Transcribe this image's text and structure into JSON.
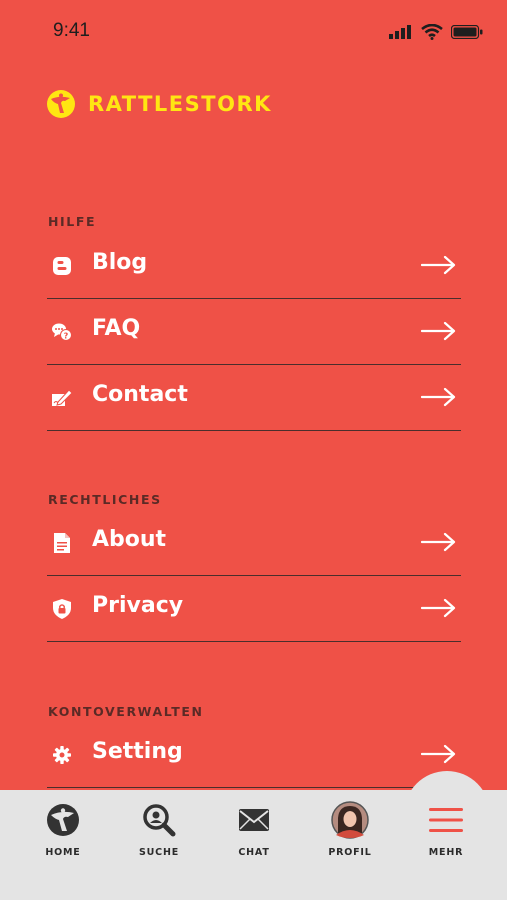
{
  "status": {
    "time": "9:41"
  },
  "brand": {
    "name": "RATTLESTORK",
    "color": "#ffe612",
    "icon": "stork-logo-icon"
  },
  "colors": {
    "background": "#ef5147",
    "tabbar": "#e4e4e4",
    "accent": "#ef5147"
  },
  "sections": [
    {
      "title": "HILFE",
      "items": [
        {
          "label": "Blog",
          "icon": "blog-icon"
        },
        {
          "label": "FAQ",
          "icon": "faq-icon"
        },
        {
          "label": "Contact",
          "icon": "contact-icon"
        }
      ]
    },
    {
      "title": "RECHTLICHES",
      "items": [
        {
          "label": "About",
          "icon": "document-icon"
        },
        {
          "label": "Privacy",
          "icon": "shield-lock-icon"
        }
      ]
    },
    {
      "title": "KONTOVERWALTEN",
      "items": [
        {
          "label": "Setting",
          "icon": "gear-icon"
        }
      ]
    }
  ],
  "tabs": [
    {
      "label": "HOME",
      "icon": "stork-icon"
    },
    {
      "label": "SUCHE",
      "icon": "search-icon"
    },
    {
      "label": "CHAT",
      "icon": "mail-icon"
    },
    {
      "label": "PROFIL",
      "icon": "avatar"
    },
    {
      "label": "MEHR",
      "icon": "hamburger-menu-icon",
      "active": true
    }
  ]
}
